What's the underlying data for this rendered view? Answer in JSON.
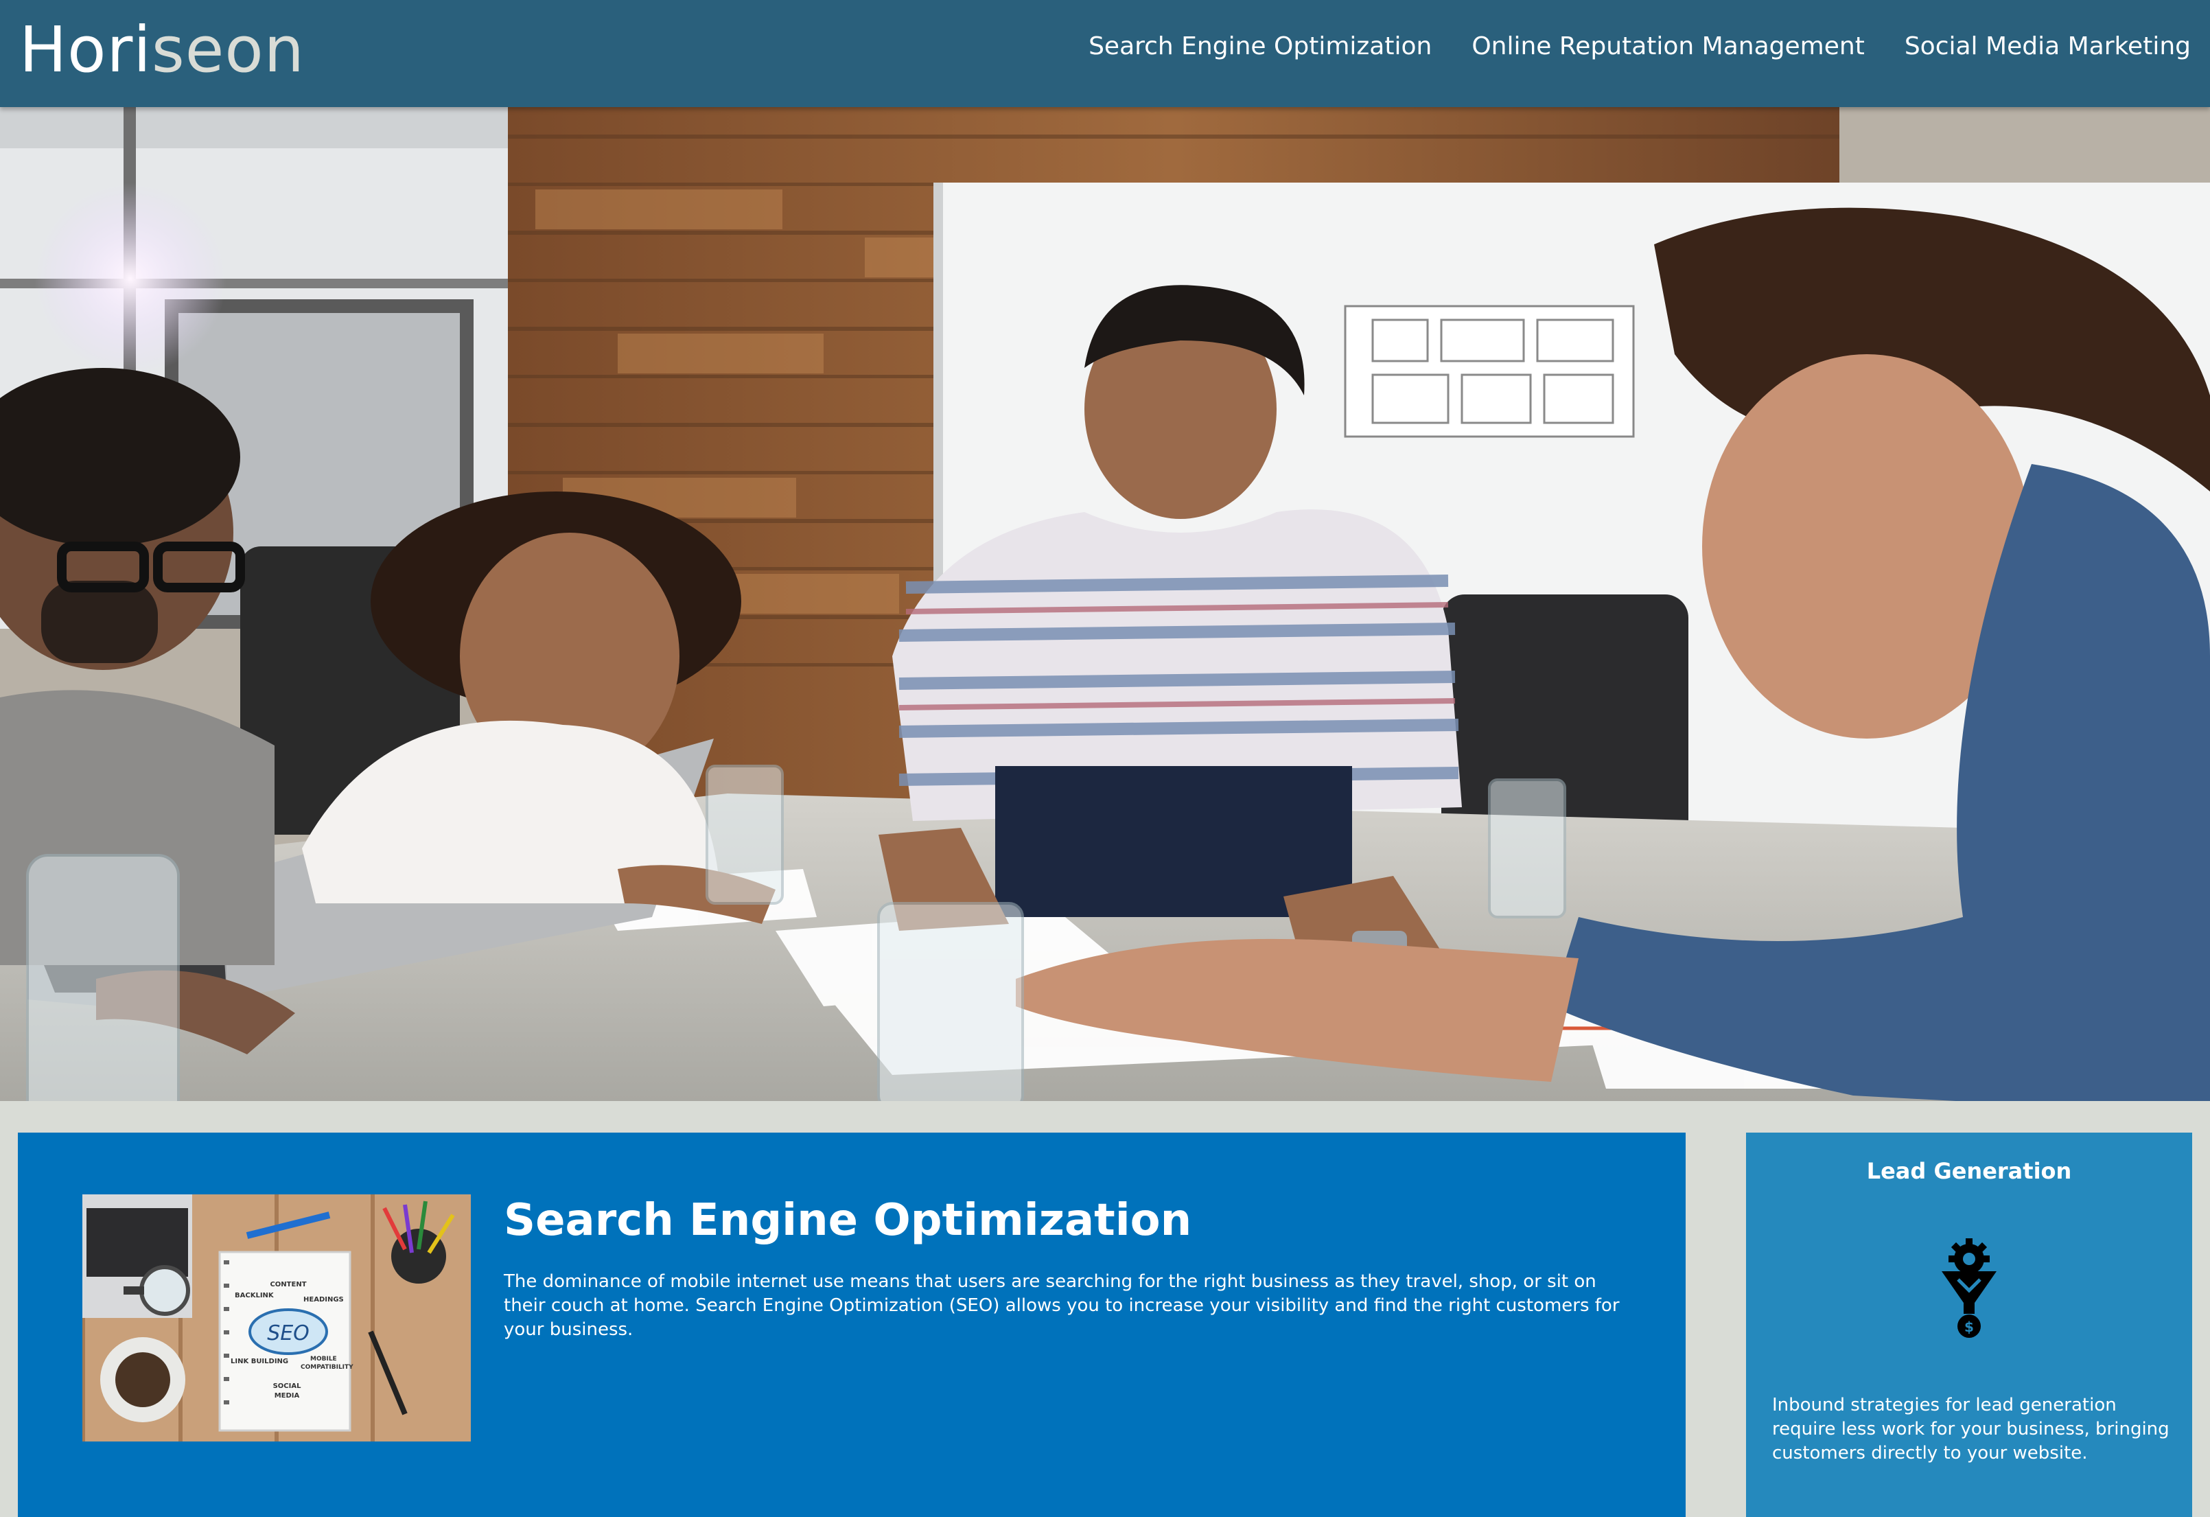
{
  "header": {
    "logo_prefix": "Hori",
    "logo_suffix": "seon",
    "nav": [
      {
        "label": "Search Engine Optimization"
      },
      {
        "label": "Online Reputation Management"
      },
      {
        "label": "Social Media Marketing"
      }
    ]
  },
  "hero": {
    "image": "team-meeting-photo"
  },
  "content": {
    "title": "Search Engine Optimization",
    "body": "The dominance of mobile internet use means that users are searching for the right business as they travel, shop, or sit on their couch at home. Search Engine Optimization (SEO) allows you to increase your visibility and find the right customers for your business.",
    "image": {
      "labels": {
        "content": "CONTENT",
        "backlink": "BACKLINK",
        "headings": "HEADINGS",
        "seo": "SEO",
        "link_building": "LINK BUILDING",
        "mobile": "MOBILE",
        "compatibility": "COMPATIBILITY",
        "social": "SOCIAL",
        "media": "MEDIA"
      }
    }
  },
  "sidebar": {
    "title": "Lead Generation",
    "icon": "lead-generation-funnel-icon",
    "body": "Inbound strategies for lead generation require less work for your business, bringing customers directly to your website."
  },
  "colors": {
    "header_bg": "#2a607c",
    "content_bg": "#0072bb",
    "sidebar_bg": "#2589bd",
    "page_bg": "#d9dcd6"
  }
}
